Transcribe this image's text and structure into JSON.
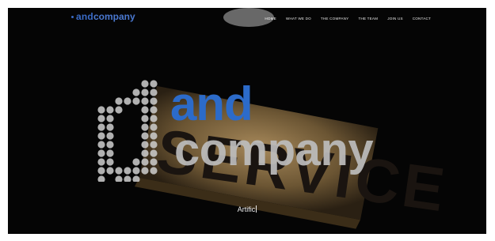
{
  "header": {
    "brand_and": "and",
    "brand_company": "company"
  },
  "nav": {
    "items": [
      {
        "label": "HOME",
        "active": true
      },
      {
        "label": "WHAT WE DO"
      },
      {
        "label": "THE COMPANY"
      },
      {
        "label": "THE TEAM"
      },
      {
        "label": "JOIN US"
      },
      {
        "label": "CONTACT"
      }
    ]
  },
  "hero": {
    "logo_and": "and",
    "logo_company": "company",
    "sign_text": "SERVICE",
    "caption": "Artific"
  },
  "colors": {
    "brand_blue": "#2c6bc9",
    "logo_grey": "#bdbdbd",
    "background": "#050505"
  }
}
